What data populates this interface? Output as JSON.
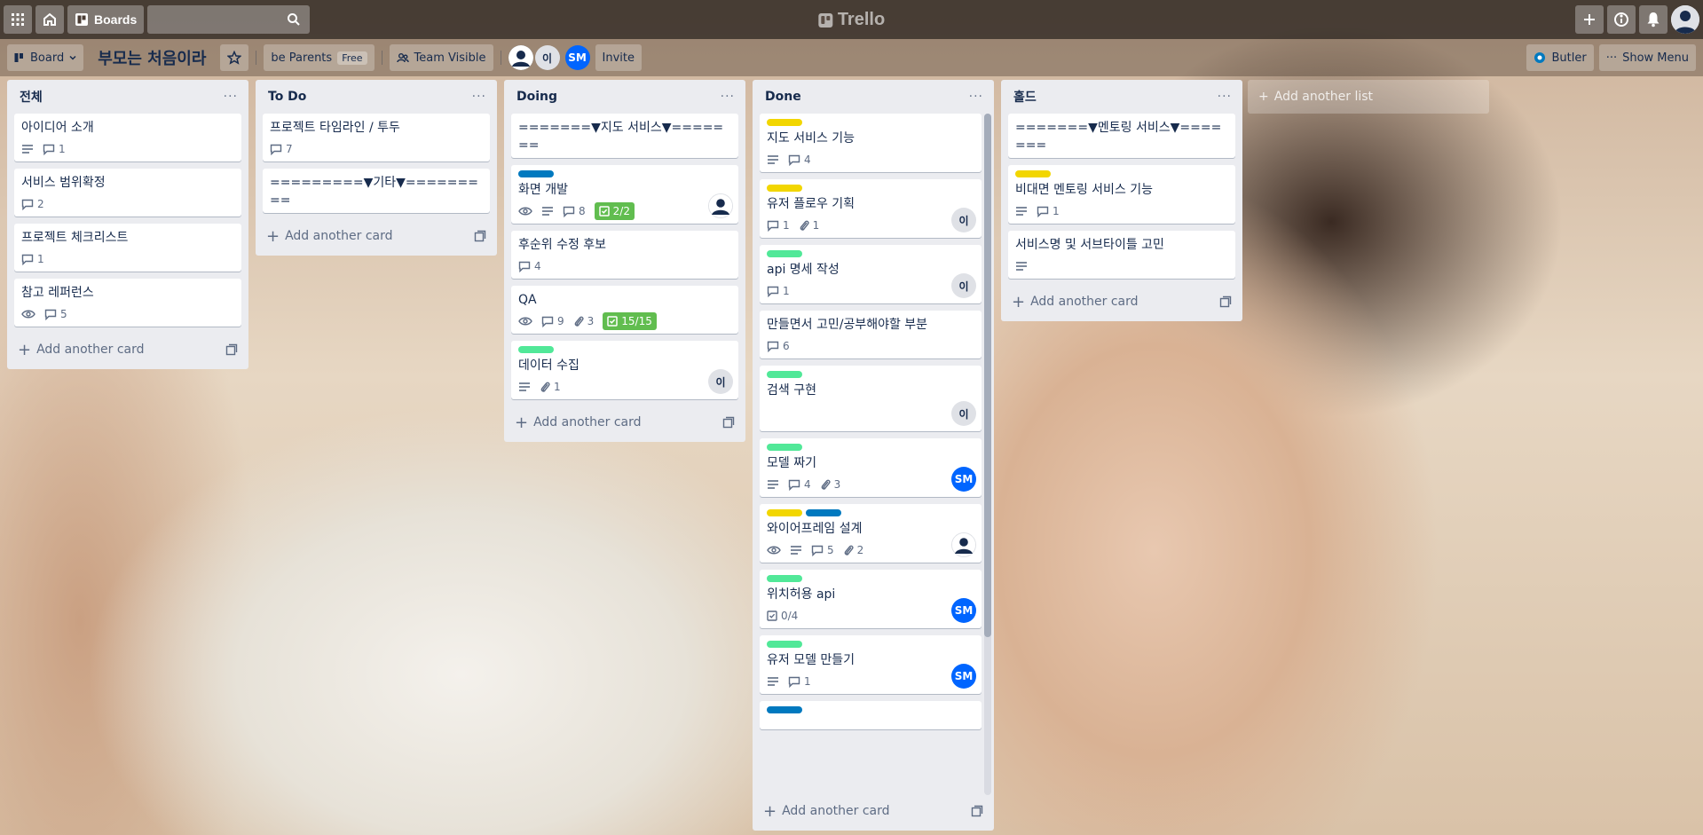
{
  "header": {
    "boards_label": "Boards",
    "search_placeholder": "",
    "logo_text": "Trello"
  },
  "board": {
    "view_label": "Board",
    "title": "부모는 처음이라",
    "team_name": "be Parents",
    "team_plan": "Free",
    "visibility_label": "Team Visible",
    "members": [
      "이",
      "SM"
    ],
    "invite_label": "Invite",
    "butler_label": "Butler",
    "menu_label": "Show Menu"
  },
  "lists": [
    {
      "title": "전체",
      "cards": [
        {
          "title": "아이디어 소개",
          "desc": true,
          "comments": "1"
        },
        {
          "title": "서비스 범위확정",
          "comments": "2"
        },
        {
          "title": "프로젝트 체크리스트",
          "comments": "1"
        },
        {
          "title": "참고 레퍼런스",
          "watch": true,
          "comments": "5"
        }
      ]
    },
    {
      "title": "To Do",
      "cards": [
        {
          "title": "프로젝트 타임라인 / 투두",
          "comments": "7"
        },
        {
          "title": "=========▼기타▼========="
        }
      ]
    },
    {
      "title": "Doing",
      "cards": [
        {
          "title": "=======▼지도 서비스▼======="
        },
        {
          "title": "화면 개발",
          "labels": [
            "#0079bf"
          ],
          "watch": true,
          "desc": true,
          "comments": "8",
          "checklist": "2/2",
          "member": "dark"
        },
        {
          "title": "후순위 수정 후보",
          "comments": "4"
        },
        {
          "title": "QA",
          "watch": true,
          "comments": "9",
          "attachments": "3",
          "checklist": "15/15"
        },
        {
          "title": "데이터 수집",
          "labels": [
            "#51e898"
          ],
          "desc": true,
          "attachments": "1",
          "member": "이"
        }
      ]
    },
    {
      "title": "Done",
      "cards": [
        {
          "title": "지도 서비스 기능",
          "labels": [
            "#f2d600"
          ],
          "desc": true,
          "comments": "4"
        },
        {
          "title": "유저 플로우 기획",
          "labels": [
            "#f2d600"
          ],
          "comments": "1",
          "attachments": "1",
          "member": "이"
        },
        {
          "title": "api 명세 작성",
          "labels": [
            "#51e898"
          ],
          "comments": "1",
          "member": "이"
        },
        {
          "title": "만들면서 고민/공부해야할 부분",
          "comments": "6"
        },
        {
          "title": "검색 구현",
          "labels": [
            "#51e898"
          ],
          "member": "이"
        },
        {
          "title": "모델 짜기",
          "labels": [
            "#51e898"
          ],
          "desc": true,
          "comments": "4",
          "attachments": "3",
          "member": "SM"
        },
        {
          "title": "와이어프레임 설계",
          "labels": [
            "#f2d600",
            "#0079bf"
          ],
          "watch": true,
          "desc": true,
          "comments": "5",
          "attachments": "2",
          "member": "dark"
        },
        {
          "title": "위치허용 api",
          "labels": [
            "#51e898"
          ],
          "checklist_plain": "0/4",
          "member": "SM"
        },
        {
          "title": "유저 모델 만들기",
          "labels": [
            "#51e898"
          ],
          "desc": true,
          "comments": "1",
          "member": "SM"
        },
        {
          "title": "",
          "labels": [
            "#0079bf"
          ]
        }
      ]
    },
    {
      "title": "홀드",
      "cards": [
        {
          "title": "=======▼멘토링 서비스▼======="
        },
        {
          "title": "비대면 멘토링 서비스 기능",
          "labels": [
            "#f2d600"
          ],
          "desc": true,
          "comments": "1"
        },
        {
          "title": "서비스명 및 서브타이틀 고민",
          "desc": true
        }
      ]
    }
  ],
  "add_card_label": "Add another card",
  "add_list_label": "Add another list",
  "colors": {
    "label_yellow": "#f2d600",
    "label_green": "#51e898",
    "label_blue": "#0079bf",
    "checklist_done": "#61bd4f",
    "member_blue": "#0065ff"
  }
}
